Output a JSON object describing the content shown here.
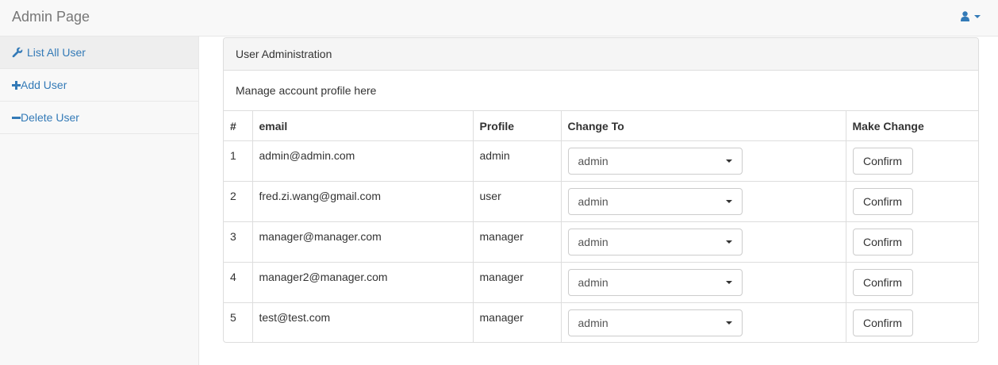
{
  "brand": "Admin Page",
  "sidebar": {
    "items": [
      {
        "label": "List All User",
        "icon": "wrench-icon"
      },
      {
        "label": "Add User",
        "icon": "plus-icon"
      },
      {
        "label": "Delete User",
        "icon": "minus-icon"
      }
    ]
  },
  "panel": {
    "heading": "User Administration",
    "body": "Manage account profile here"
  },
  "table": {
    "headers": [
      "#",
      "email",
      "Profile",
      "Change To",
      "Make Change"
    ],
    "rows": [
      {
        "num": "1",
        "email": "admin@admin.com",
        "profile": "admin",
        "change_to": "admin",
        "action": "Confirm"
      },
      {
        "num": "2",
        "email": "fred.zi.wang@gmail.com",
        "profile": "user",
        "change_to": "admin",
        "action": "Confirm"
      },
      {
        "num": "3",
        "email": "manager@manager.com",
        "profile": "manager",
        "change_to": "admin",
        "action": "Confirm"
      },
      {
        "num": "4",
        "email": "manager2@manager.com",
        "profile": "manager",
        "change_to": "admin",
        "action": "Confirm"
      },
      {
        "num": "5",
        "email": "test@test.com",
        "profile": "manager",
        "change_to": "admin",
        "action": "Confirm"
      }
    ]
  },
  "colors": {
    "link": "#337ab7",
    "navbar": "#f8f8f8",
    "border": "#dddddd"
  }
}
